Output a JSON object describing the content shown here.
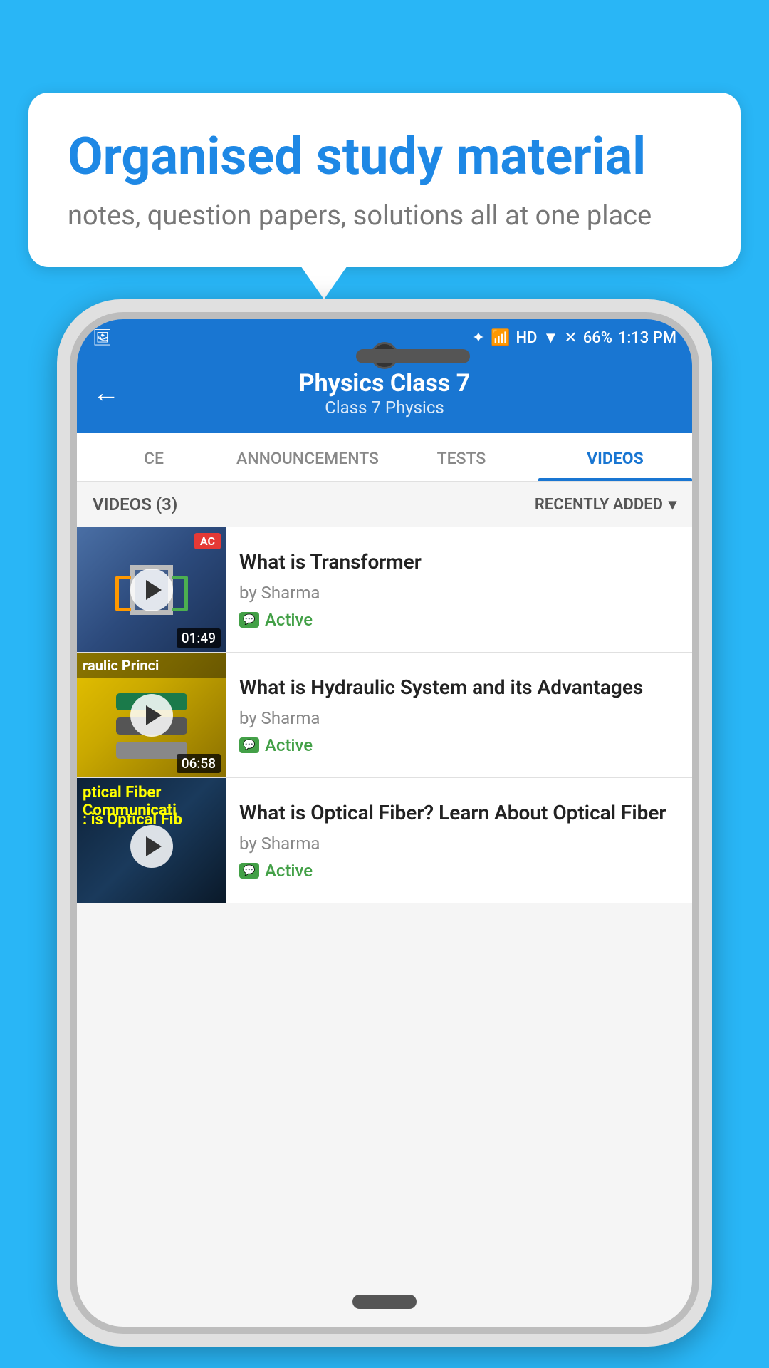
{
  "background": "#29b6f6",
  "bubble": {
    "title": "Organised study material",
    "subtitle": "notes, question papers, solutions all at one place"
  },
  "statusBar": {
    "time": "1:13 PM",
    "battery": "66%",
    "signal": "HD"
  },
  "header": {
    "title": "Physics Class 7",
    "breadcrumb": "Class 7   Physics",
    "back_label": "←"
  },
  "tabs": [
    {
      "id": "ce",
      "label": "CE",
      "active": false
    },
    {
      "id": "announcements",
      "label": "ANNOUNCEMENTS",
      "active": false
    },
    {
      "id": "tests",
      "label": "TESTS",
      "active": false
    },
    {
      "id": "videos",
      "label": "VIDEOS",
      "active": true
    }
  ],
  "videos_section": {
    "count_label": "VIDEOS (3)",
    "sort_label": "RECENTLY ADDED",
    "sort_icon": "▾"
  },
  "videos": [
    {
      "title": "What is  Transformer",
      "author": "by Sharma",
      "status": "Active",
      "duration": "01:49",
      "thumb_type": "transformer"
    },
    {
      "title": "What is Hydraulic System and its Advantages",
      "author": "by Sharma",
      "status": "Active",
      "duration": "06:58",
      "thumb_type": "hydraulic"
    },
    {
      "title": "What is Optical Fiber? Learn About Optical Fiber",
      "author": "by Sharma",
      "status": "Active",
      "duration": "",
      "thumb_type": "optical"
    }
  ]
}
